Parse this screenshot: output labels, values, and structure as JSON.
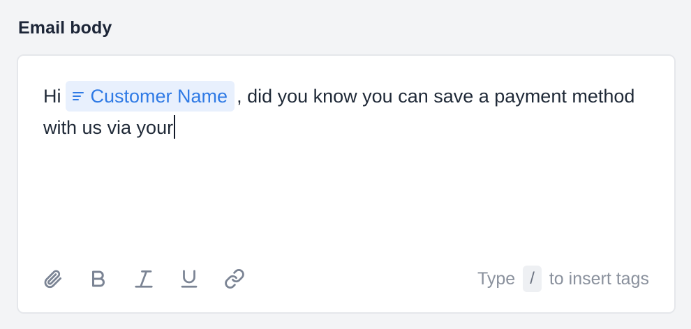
{
  "field": {
    "label": "Email body"
  },
  "editor": {
    "text_before": "Hi",
    "tag_chip": {
      "label": "Customer Name",
      "icon": "text-lines-icon"
    },
    "text_after": ", did you know you can save a payment method with us via your"
  },
  "toolbar": {
    "buttons": [
      {
        "name": "attach",
        "icon": "paperclip-icon"
      },
      {
        "name": "bold",
        "icon": "bold-icon"
      },
      {
        "name": "italic",
        "icon": "italic-icon"
      },
      {
        "name": "underline",
        "icon": "underline-icon"
      },
      {
        "name": "link",
        "icon": "link-icon"
      }
    ]
  },
  "hint": {
    "prefix": "Type",
    "key": "/",
    "suffix": "to insert tags"
  },
  "colors": {
    "page_background": "#f3f4f6",
    "editor_background": "#ffffff",
    "chip_background": "#e8f0fd",
    "chip_text": "#2f7ae5",
    "icon_gray": "#7b8494"
  }
}
